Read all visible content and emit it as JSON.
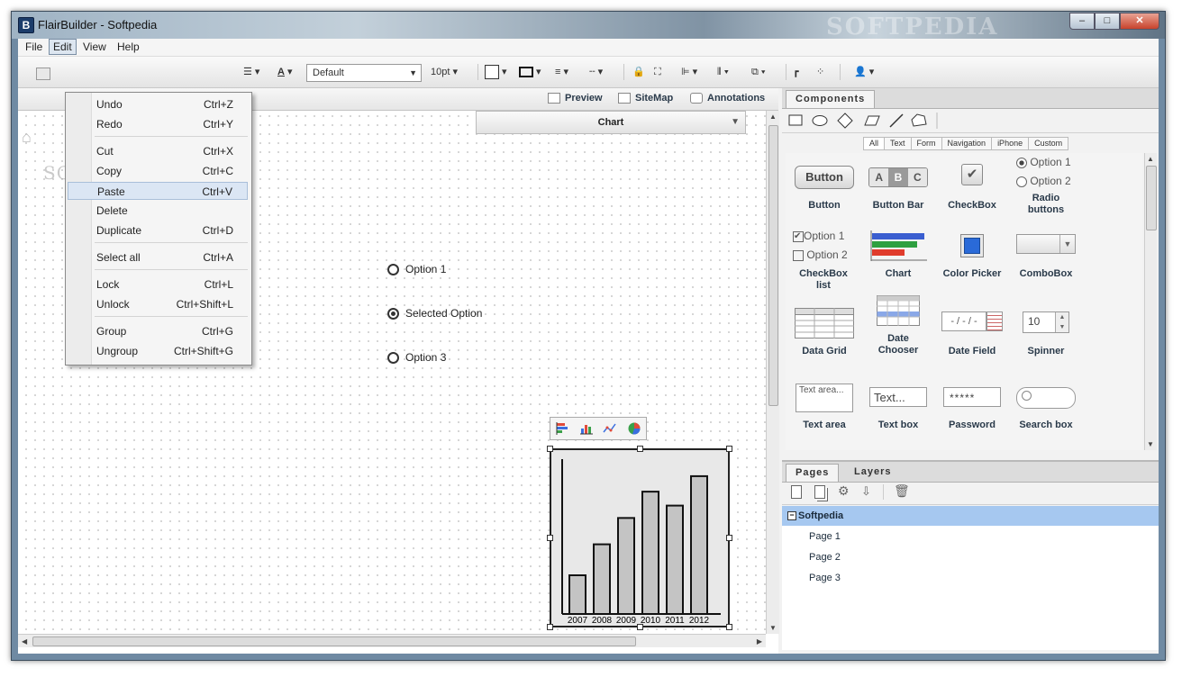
{
  "window": {
    "title": "FlairBuilder - Softpedia",
    "app_icon": "B",
    "title_watermark": "SOFTPEDIA",
    "controls": {
      "minimize": "–",
      "maximize": "□",
      "close": "✕"
    }
  },
  "menubar": {
    "items": [
      "File",
      "Edit",
      "View",
      "Help"
    ],
    "active": "Edit"
  },
  "edit_menu": {
    "items": [
      {
        "label": "Undo",
        "shortcut": "Ctrl+Z"
      },
      {
        "label": "Redo",
        "shortcut": "Ctrl+Y"
      },
      {
        "label": "Cut",
        "shortcut": "Ctrl+X"
      },
      {
        "label": "Copy",
        "shortcut": "Ctrl+C"
      },
      {
        "label": "Paste",
        "shortcut": "Ctrl+V"
      },
      {
        "label": "Delete",
        "shortcut": ""
      },
      {
        "label": "Duplicate",
        "shortcut": "Ctrl+D"
      },
      {
        "label": "Select all",
        "shortcut": "Ctrl+A"
      },
      {
        "label": "Lock",
        "shortcut": "Ctrl+L"
      },
      {
        "label": "Unlock",
        "shortcut": "Ctrl+Shift+L"
      },
      {
        "label": "Group",
        "shortcut": "Ctrl+G"
      },
      {
        "label": "Ungroup",
        "shortcut": "Ctrl+Shift+G"
      }
    ],
    "highlighted": "Paste"
  },
  "toolbar": {
    "font_family": "Default",
    "font_size": "10pt"
  },
  "canvas_header": {
    "preview": "Preview",
    "sitemap": "SiteMap",
    "annotations": "Annotations"
  },
  "canvas": {
    "watermark": "SOFTPEDIA",
    "property_panel_title": "Chart",
    "radio_options": [
      {
        "label": "Option 1",
        "selected": false
      },
      {
        "label": "Selected Option",
        "selected": true
      },
      {
        "label": "Option 3",
        "selected": false
      }
    ],
    "chart_data": {
      "type": "bar",
      "categories": [
        "2007",
        "2008",
        "2009",
        "2010",
        "2011",
        "2012"
      ],
      "values": [
        25,
        45,
        62,
        79,
        70,
        89
      ],
      "ylim": [
        0,
        100
      ],
      "title": "",
      "xlabel": "",
      "ylabel": ""
    }
  },
  "components_panel": {
    "tab": "Components",
    "filters": [
      "All",
      "Text",
      "Form",
      "Navigation",
      "iPhone",
      "Custom"
    ],
    "active_filter": "All",
    "items": [
      {
        "label": "Button",
        "preview": "Button"
      },
      {
        "label": "Button Bar",
        "preview": [
          "A",
          "B",
          "C"
        ]
      },
      {
        "label": "CheckBox",
        "preview": "✔"
      },
      {
        "label": "Radio buttons",
        "preview": [
          "Option 1",
          "Option 2"
        ]
      },
      {
        "label": "CheckBox list",
        "preview": [
          "Option 1",
          "Option 2"
        ]
      },
      {
        "label": "Chart",
        "preview": ""
      },
      {
        "label": "Color Picker",
        "preview": ""
      },
      {
        "label": "ComboBox",
        "preview": ""
      },
      {
        "label": "Data Grid",
        "preview": ""
      },
      {
        "label": "Date Chooser",
        "preview": ""
      },
      {
        "label": "Date Field",
        "preview": "- / - / -"
      },
      {
        "label": "Spinner",
        "preview": "10"
      },
      {
        "label": "Text area",
        "preview": "Text area..."
      },
      {
        "label": "Text box",
        "preview": "Text..."
      },
      {
        "label": "Password",
        "preview": "*****"
      },
      {
        "label": "Search box",
        "preview": ""
      }
    ]
  },
  "pages_panel": {
    "tabs": [
      "Pages",
      "Layers"
    ],
    "active_tab": "Pages",
    "project": "Softpedia",
    "pages": [
      "Page 1",
      "Page 2",
      "Page 3"
    ]
  }
}
